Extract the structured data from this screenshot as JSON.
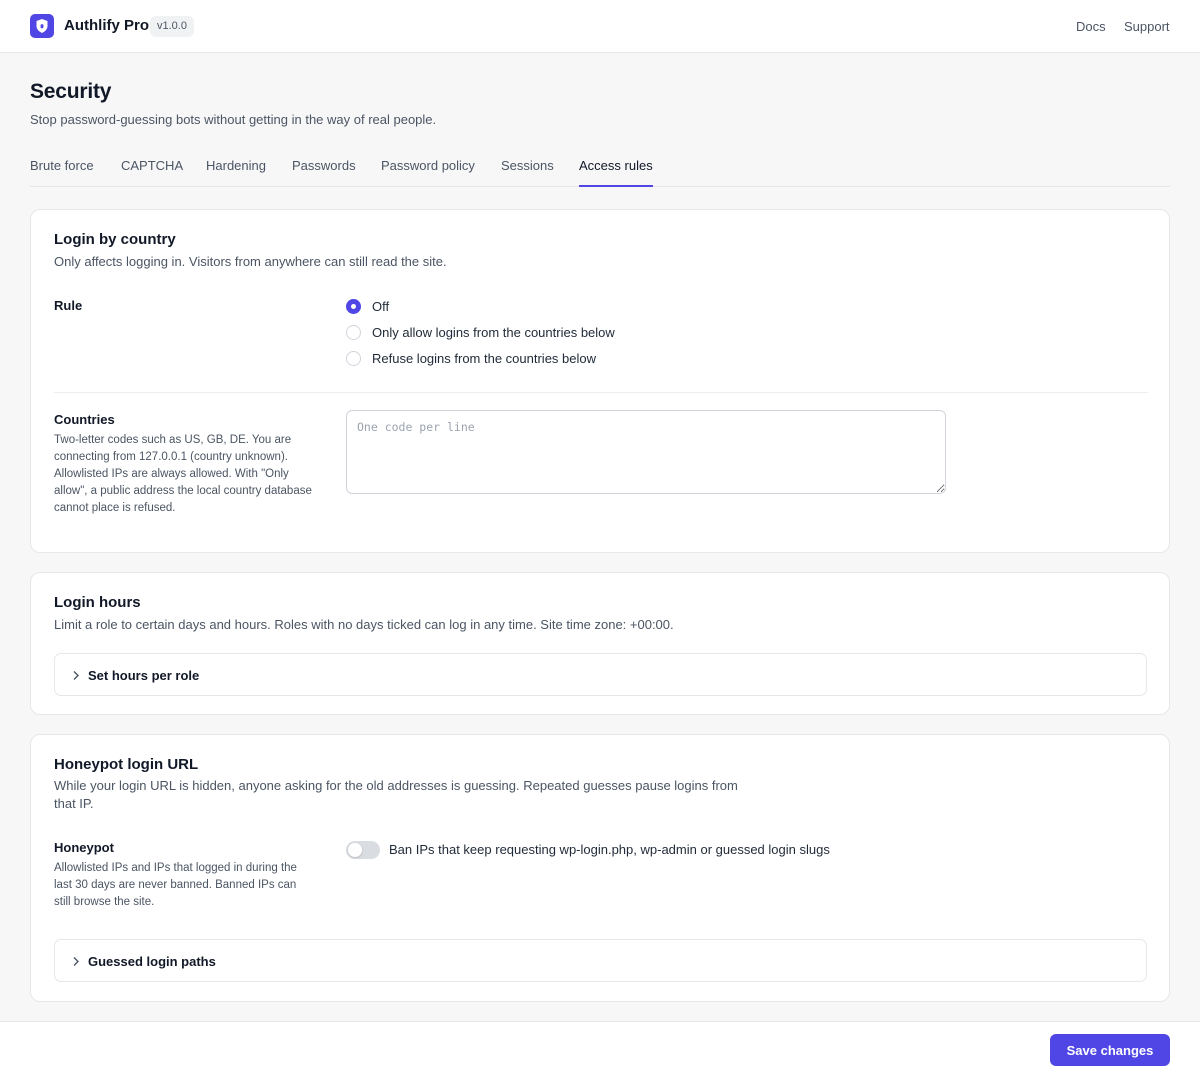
{
  "app": {
    "name": "Authlify Pro",
    "version": "v1.0.0",
    "logo_icon": "shield-icon",
    "accent_color": "#4f46e5"
  },
  "topnav": {
    "docs": "Docs",
    "support": "Support"
  },
  "page": {
    "title": "Security",
    "subtitle": "Stop password-guessing bots without getting in the way of real people."
  },
  "tabs": [
    {
      "label": "Brute force",
      "active": false
    },
    {
      "label": "CAPTCHA",
      "active": false
    },
    {
      "label": "Hardening",
      "active": false
    },
    {
      "label": "Passwords",
      "active": false
    },
    {
      "label": "Password policy",
      "active": false
    },
    {
      "label": "Sessions",
      "active": false
    },
    {
      "label": "Access rules",
      "active": true
    }
  ],
  "login_by_country": {
    "title": "Login by country",
    "description": "Only affects logging in. Visitors from anywhere can still read the site.",
    "rule_label": "Rule",
    "rule_options": [
      {
        "label": "Off",
        "checked": true
      },
      {
        "label": "Only allow logins from the countries below",
        "checked": false
      },
      {
        "label": "Refuse logins from the countries below",
        "checked": false
      }
    ],
    "countries_label": "Countries",
    "countries_help": "Two-letter codes such as US, GB, DE. You are connecting from 127.0.0.1 (country unknown). Allowlisted IPs are always allowed. With \"Only allow\", a public address the local country database cannot place is refused.",
    "countries_value": "",
    "countries_placeholder": "One code per line"
  },
  "login_hours": {
    "title": "Login hours",
    "description": "Limit a role to certain days and hours. Roles with no days ticked can log in any time. Site time zone: +00:00.",
    "disclosure_label": "Set hours per role"
  },
  "honeypot": {
    "title": "Honeypot login URL",
    "description": "While your login URL is hidden, anyone asking for the old addresses is guessing. Repeated guesses pause logins from that IP.",
    "field_label": "Honeypot",
    "field_help": "Allowlisted IPs and IPs that logged in during the last 30 days are never banned. Banned IPs can still browse the site.",
    "toggle_label": "Ban IPs that keep requesting wp-login.php, wp-admin or guessed login slugs",
    "toggle_on": false,
    "disclosure_label": "Guessed login paths"
  },
  "footer": {
    "save_label": "Save changes"
  }
}
